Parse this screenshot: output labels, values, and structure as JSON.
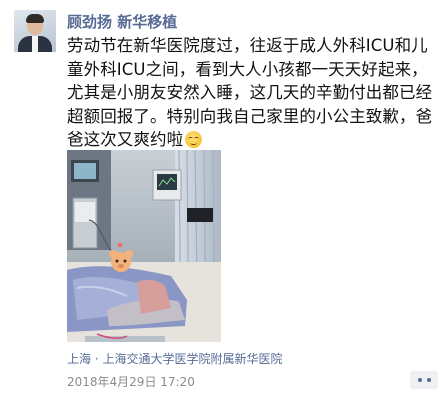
{
  "post": {
    "author": "顾劲扬 新华移植",
    "text": "劳动节在新华医院度过，往返于成人外科ICU和儿童外科ICU之间，看到大人小孩都一天天好起来，尤其是小朋友安然入睡，这几天的辛勤付出都已经超额回报了。特别向我自己家里的小公主致歉，爸爸这次又爽约啦",
    "emoji": "smiling-face-emoji",
    "location": "上海 · 上海交通大学医学院附属新华医院",
    "timestamp": "2018年4月29日 17:20"
  },
  "icons": {
    "avatar": "author-avatar",
    "photo": "hospital-photo",
    "more": "more-options-icon"
  },
  "colors": {
    "link": "#576b95",
    "text": "#111111",
    "meta": "#8c8c8c"
  }
}
